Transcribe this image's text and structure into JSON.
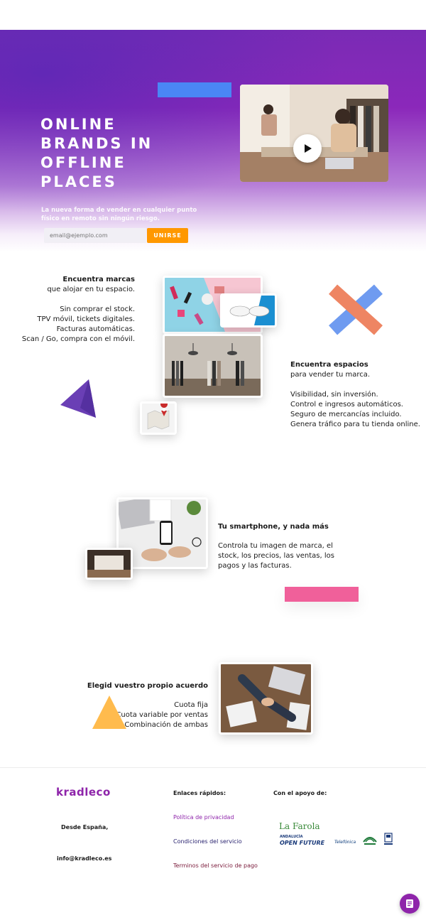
{
  "hero": {
    "title_lines": [
      "ONLINE",
      "BRANDS IN",
      "OFFLINE",
      "PLACES"
    ],
    "subtitle": "La nueva forma de vender en cualquier punto físico en remoto sin ningún riesgo.",
    "email_placeholder": "email@ejemplo.com",
    "join_label": "UNIRSE"
  },
  "section_brands": {
    "heading": "Encuentra marcas",
    "line1": "que alojar en tu espacio.",
    "items": [
      "Sin comprar el stock.",
      "TPV móvil, tickets digitales.",
      "Facturas automáticas.",
      "Scan / Go, compra con el móvil."
    ]
  },
  "section_spaces": {
    "heading": "Encuentra espacios",
    "line1": "para vender tu marca.",
    "items": [
      "Visibilidad, sin inversión.",
      "Control e ingresos automáticos.",
      "Seguro de mercancías incluido.",
      "Genera tráfico para tu tienda online."
    ]
  },
  "section_smartphone": {
    "heading": "Tu smartphone, y nada más",
    "body_lines": [
      "Controla tu imagen de marca, el",
      "stock, los precios, las ventas, los",
      "pagos y las facturas."
    ]
  },
  "section_agreement": {
    "heading": "Elegid vuestro propio acuerdo",
    "items": [
      "Cuota fija",
      "Cuota variable por ventas",
      "Combinación de ambas"
    ]
  },
  "footer": {
    "logo": "kradleco",
    "origin": "Desde España,",
    "email": "info@kradleco.es",
    "links_heading": "Enlaces rápidos:",
    "links": [
      "Política de privacidad",
      "Condiciones del servicio",
      "Terminos del servicio de pago"
    ],
    "support_heading": "Con el apoyo de:",
    "partners": [
      "La Farola",
      "ANDALUCÍA",
      "OPEN FUTURE",
      "Telefónica"
    ]
  },
  "colors": {
    "purple": "#8e24aa",
    "blue_bar": "#4a86f5",
    "orange": "#ff9800",
    "pink_bar": "#f0609a",
    "triangle_purple": "#6a3fb5",
    "triangle_yellow": "#ffbb4d",
    "cross_blue": "#6f9bf0",
    "cross_orange": "#ee8563"
  }
}
